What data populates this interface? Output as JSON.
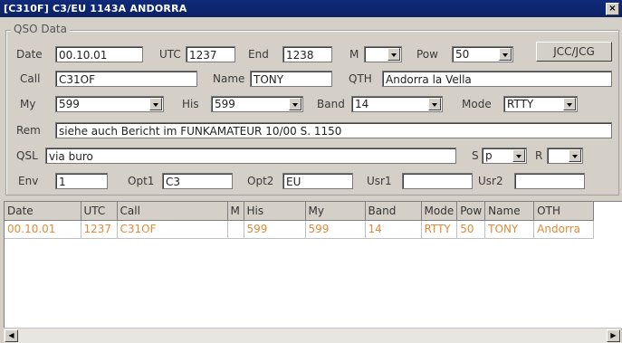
{
  "window": {
    "title": "[C310F] C3/EU 1143A ANDORRA",
    "close_glyph": "×"
  },
  "group": {
    "legend": "QSO Data"
  },
  "form": {
    "date_label": "Date",
    "date_value": "00.10.01",
    "utc_label": "UTC",
    "utc_value": "1237",
    "end_label": "End",
    "end_value": "1238",
    "m_label": "M",
    "m_value": "",
    "pow_label": "Pow",
    "pow_value": "50",
    "jcc_button": "JCC/JCG",
    "call_label": "Call",
    "call_value": "C31OF",
    "name_label": "Name",
    "name_value": "TONY",
    "qth_label": "QTH",
    "qth_value": "Andorra la Vella",
    "my_label": "My",
    "my_value": "599",
    "his_label": "His",
    "his_value": "599",
    "band_label": "Band",
    "band_value": "14",
    "mode_label": "Mode",
    "mode_value": "RTTY",
    "rem_label": "Rem",
    "rem_value": "siehe auch Bericht  im FUNKAMATEUR 10/00 S. 1150",
    "qsl_label": "QSL",
    "qsl_value": "via buro",
    "s_label": "S",
    "s_value": "p",
    "r_label": "R",
    "r_value": "",
    "env_label": "Env",
    "env_value": "1",
    "opt1_label": "Opt1",
    "opt1_value": "C3",
    "opt2_label": "Opt2",
    "opt2_value": "EU",
    "usr1_label": "Usr1",
    "usr1_value": "",
    "usr2_label": "Usr2",
    "usr2_value": ""
  },
  "log_table": {
    "columns": [
      "Date",
      "UTC",
      "Call",
      "M",
      "His",
      "My",
      "Band",
      "Mode",
      "Pow",
      "Name",
      "OTH"
    ],
    "rows": [
      [
        "00.10.01",
        "1237",
        "C31OF",
        "",
        "599",
        "599",
        "14",
        "RTTY",
        "50",
        "TONY",
        "Andorra"
      ]
    ],
    "row_color": "#e08a3a"
  },
  "scrollbar": {
    "left_glyph": "◀",
    "right_glyph": "▶"
  }
}
